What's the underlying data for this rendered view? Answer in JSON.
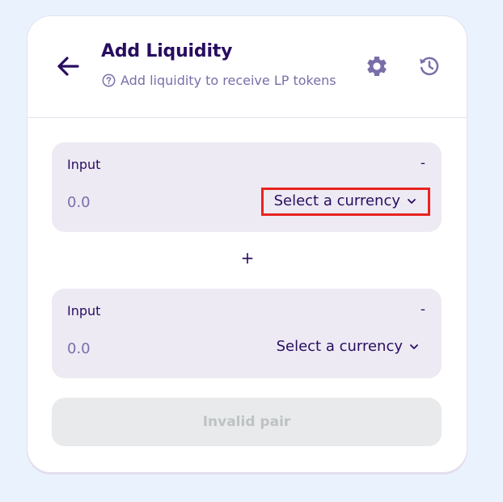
{
  "header": {
    "title": "Add Liquidity",
    "subtitle": "Add liquidity to receive LP tokens",
    "back_icon": "arrow-left-icon",
    "settings_icon": "gear-icon",
    "history_icon": "history-icon"
  },
  "panels": [
    {
      "label": "Input",
      "balance": "-",
      "amount_placeholder": "0.0",
      "currency_label": "Select a currency"
    },
    {
      "label": "Input",
      "balance": "-",
      "amount_placeholder": "0.0",
      "currency_label": "Select a currency"
    }
  ],
  "plus_sign": "+",
  "submit": {
    "label": "Invalid pair"
  },
  "colors": {
    "primary_text": "#280d5f",
    "secondary_text": "#7a6eaa",
    "panel_bg": "#eeeaf4",
    "page_bg": "#eaf3fd",
    "disabled_text": "#bdc2c4",
    "highlight": "#e8231f"
  }
}
